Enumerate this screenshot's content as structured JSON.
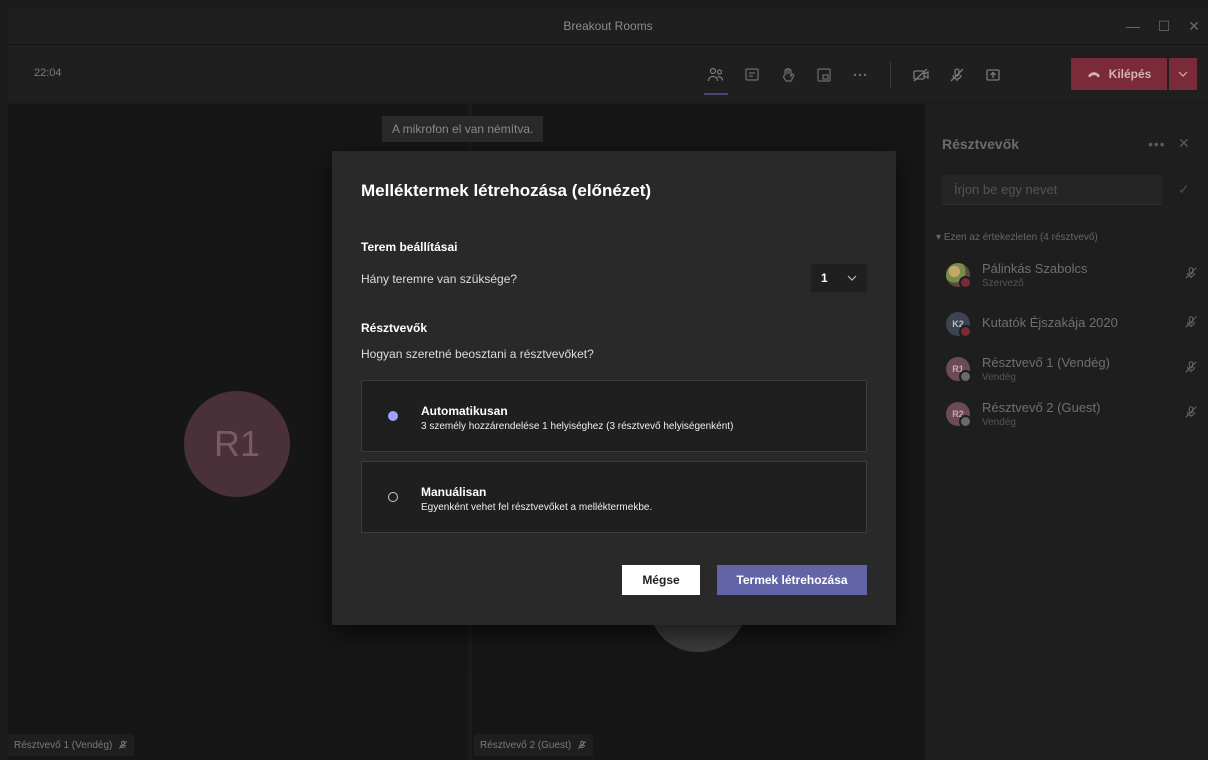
{
  "window": {
    "title": "Breakout Rooms"
  },
  "toolbar": {
    "clock": "22:04",
    "icons": [
      "participants-icon",
      "chat-icon",
      "raise-hand-icon",
      "breakout-rooms-icon",
      "more-icon",
      "camera-off-icon",
      "mic-off-icon",
      "share-icon"
    ],
    "leave_label": "Kilépés"
  },
  "stage": {
    "muted_toast": "A mikrofon el van némítva.",
    "tiles": [
      {
        "initials": "R1",
        "label": "Résztvevő 1 (Vendég)"
      },
      {
        "initials": "",
        "label": "Résztvevő 2 (Guest)"
      }
    ]
  },
  "panel": {
    "title": "Résztvevők",
    "search_placeholder": "Írjon be egy nevet",
    "group_header": "Ezen az értekezleten (4 résztvevő)",
    "participants": [
      {
        "initials": "",
        "name": "Pálinkás Szabolcs",
        "role": "Szervező"
      },
      {
        "initials": "K2",
        "name": "Kutatók Éjszakája 2020",
        "role": ""
      },
      {
        "initials": "R1",
        "name": "Résztvevő 1 (Vendég)",
        "role": "Vendég"
      },
      {
        "initials": "R2",
        "name": "Résztvevő 2 (Guest)",
        "role": "Vendég"
      }
    ]
  },
  "dialog": {
    "title": "Melléktermek létrehozása (előnézet)",
    "room_settings": "Terem beállításai",
    "room_question": "Hány teremre van szüksége?",
    "room_count": "1",
    "participants_heading": "Résztvevők",
    "assign_question": "Hogyan szeretné beosztani a résztvevőket?",
    "options": [
      {
        "title": "Automatikusan",
        "subtitle": "3 személy hozzárendelése 1 helyiséghez (3 résztvevő helyiségenként)",
        "selected": true
      },
      {
        "title": "Manuálisan",
        "subtitle": "Egyenként vehet fel résztvevőket a melléktermekbe.",
        "selected": false
      }
    ],
    "cancel_label": "Mégse",
    "create_label": "Termek létrehozása"
  },
  "colors": {
    "accent": "#6264a7",
    "leave": "#7b2a37",
    "radio_selected": "#9ea2ff"
  }
}
